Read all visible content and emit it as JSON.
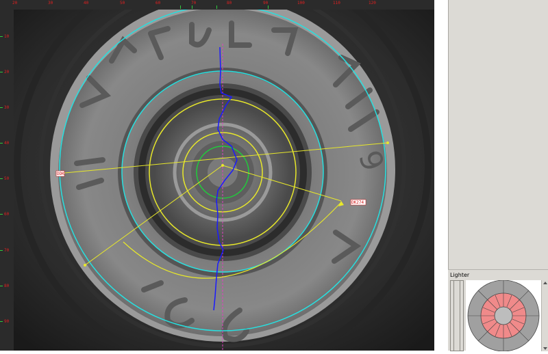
{
  "ruler": {
    "top_labels": [
      "20",
      "30",
      "40",
      "50",
      "60",
      "70",
      "80",
      "90",
      "100",
      "110",
      "120"
    ],
    "left_labels": [
      "10",
      "20",
      "30",
      "40",
      "50",
      "60",
      "70",
      "80",
      "90"
    ]
  },
  "annotations": {
    "left_marker": "DDK",
    "right_marker": "DK274"
  },
  "headstamp": {
    "letters_top": "LUGER",
    "letters_right": "9 mm",
    "letters_bottom": "CCI",
    "letters_left": "R-P",
    "digit": "9"
  },
  "lighter_panel": {
    "title": "Lighter"
  },
  "colors": {
    "ring_cyan": "#27e0e0",
    "ring_yellow": "#e8e82a",
    "ring_green": "#1ecf3a",
    "profile_blue": "#1a1aff",
    "axis_pink": "#e040c0",
    "segment_red": "#f08a8a",
    "segment_gray": "#a0a0a0"
  }
}
